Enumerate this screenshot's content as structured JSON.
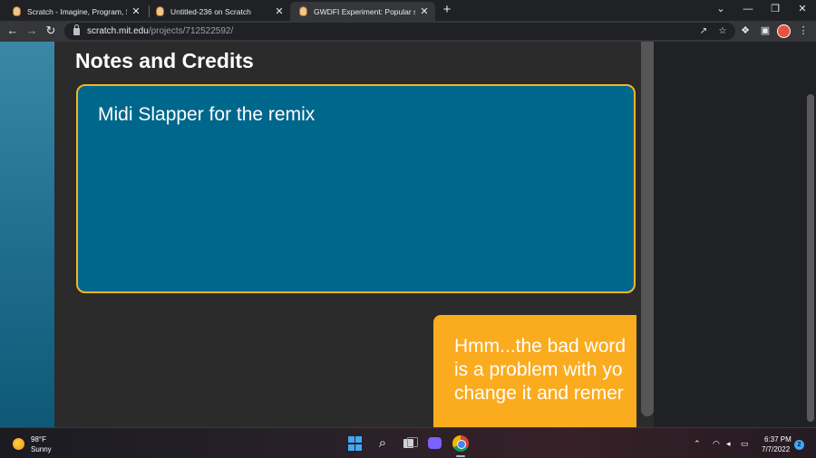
{
  "browser": {
    "tabs": [
      {
        "title": "Scratch - Imagine, Program, Shar",
        "active": false
      },
      {
        "title": "Untitled-236 on Scratch",
        "active": false
      },
      {
        "title": "GWDFI Experiment: Popular scrat",
        "active": true
      }
    ],
    "new_tab_glyph": "+",
    "tab_close_glyph": "✕",
    "url_host": "scratch.mit.edu",
    "url_path": "/projects/712522592/"
  },
  "page": {
    "notes_heading": "Notes and Credits",
    "notes_text": "Midi Slapper for the remix",
    "comment_lines": [
      "Hmm...the bad word",
      "is a problem with yo",
      "change it and remer"
    ]
  },
  "taskbar": {
    "weather_temp": "98°F",
    "weather_condition": "Sunny",
    "clock_time": "6:37 PM",
    "clock_date": "7/7/2022",
    "notification_count": "2"
  },
  "colors": {
    "notes_box_bg": "#00678c",
    "notes_box_border": "#f4b623",
    "comment_bg": "#fbab1e",
    "page_bg": "#2b2b2b"
  }
}
